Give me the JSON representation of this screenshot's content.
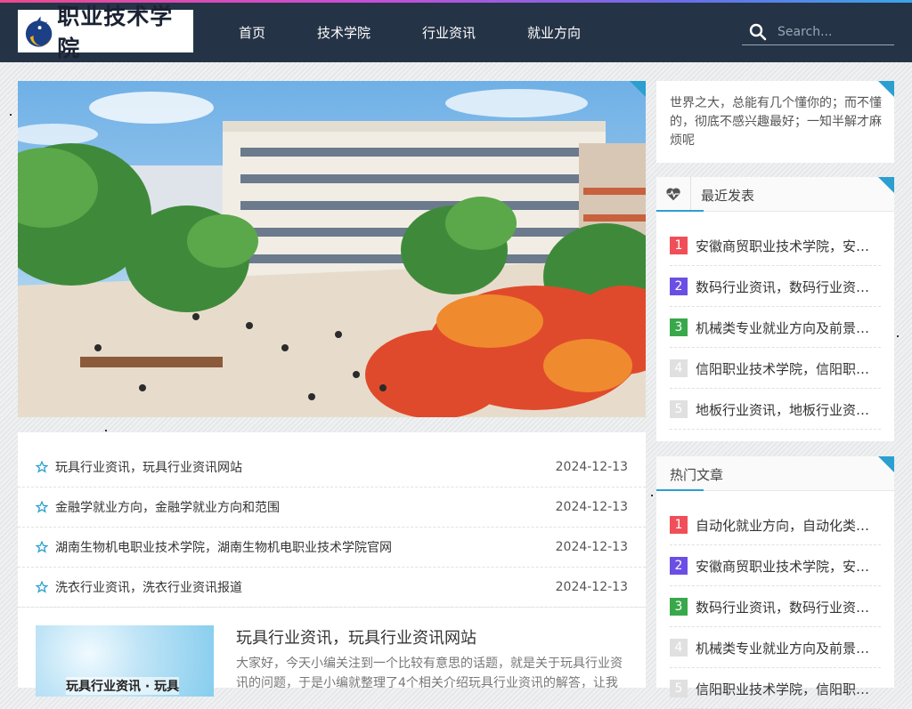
{
  "site": {
    "logo_text": "职业技术学院"
  },
  "nav": {
    "items": [
      "首页",
      "技术学院",
      "行业资讯",
      "就业方向"
    ]
  },
  "search": {
    "placeholder": "Search..."
  },
  "post_list": [
    {
      "title": "玩具行业资讯，玩具行业资讯网站",
      "date": "2024-12-13"
    },
    {
      "title": "金融学就业方向，金融学就业方向和范围",
      "date": "2024-12-13"
    },
    {
      "title": "湖南生物机电职业技术学院，湖南生物机电职业技术学院官网",
      "date": "2024-12-13"
    },
    {
      "title": "洗衣行业资讯，洗衣行业资讯报道",
      "date": "2024-12-13"
    }
  ],
  "featured": {
    "thumb_text": "玩具行业资讯 · 玩具",
    "title": "玩具行业资讯，玩具行业资讯网站",
    "excerpt": "大家好，今天小编关注到一个比较有意思的话题，就是关于玩具行业资讯的问题，于是小编就整理了4个相关介绍玩具行业资讯的解答，让我"
  },
  "sidebar": {
    "quote": "世界之大，总能有几个懂你的；而不懂的，彻底不感兴趣最好；一知半解才麻烦呢",
    "recent": {
      "title": "最近发表",
      "items": [
        "安徽商贸职业技术学院，安徽商贸职业技术学院官网",
        "数码行业资讯，数码行业资讯网站",
        "机械类专业就业方向及前景，机械类专业就业方向",
        "信阳职业技术学院，信阳职业技术学院官网",
        "地板行业资讯，地板行业资讯报道"
      ]
    },
    "hot": {
      "title": "热门文章",
      "items": [
        "自动化就业方向，自动化类专业就业方向",
        "安徽商贸职业技术学院，安徽商贸职业技术学院官网",
        "数码行业资讯，数码行业资讯网站",
        "机械类专业就业方向及前景，机械类专业就业方向",
        "信阳职业技术学院，信阳职业技术学院官网"
      ]
    }
  },
  "colors": {
    "header_bg": "#253346",
    "accent": "#2b9fd0",
    "rank1": "#f04f59",
    "rank2": "#6b4fe4",
    "rank3": "#39a84a",
    "rank_other": "#e0e0e0"
  }
}
